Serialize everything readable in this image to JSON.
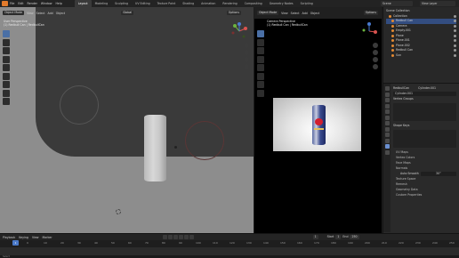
{
  "topbar": {
    "menu": [
      "File",
      "Edit",
      "Render",
      "Window",
      "Help"
    ],
    "tabs": [
      "Layout",
      "Modeling",
      "Sculpting",
      "UV Editing",
      "Texture Paint",
      "Shading",
      "Animation",
      "Rendering",
      "Compositing",
      "Geometry Nodes",
      "Scripting"
    ],
    "active_tab": "Layout",
    "scene": "Scene",
    "view_layer": "View Layer"
  },
  "viewport_left": {
    "mode": "Object Mode",
    "menus": [
      "View",
      "Select",
      "Add",
      "Object"
    ],
    "orientation": "Global",
    "options": "Options",
    "info_line1": "User Perspective",
    "info_line2": "(1) Redbull Can | RedbullCan"
  },
  "viewport_right": {
    "mode": "Object Mode",
    "menus": [
      "View",
      "Select",
      "Add",
      "Object"
    ],
    "options": "Options",
    "info_line1": "Camera Perspective",
    "info_line2": "(1) Redbull Can | RedbullCan"
  },
  "outliner": {
    "title": "Scene Collection",
    "rows": [
      {
        "label": "Collection"
      },
      {
        "label": "Redbull Can"
      },
      {
        "label": "Camera"
      },
      {
        "label": "Empty.001"
      },
      {
        "label": "Plane"
      },
      {
        "label": "Plane.001"
      },
      {
        "label": "Plane.002"
      },
      {
        "label": "Redbull Can"
      },
      {
        "label": "Sun"
      }
    ]
  },
  "properties": {
    "object_name": "RedbullCan",
    "mesh_name": "Cylinder.001",
    "data_field": "Cylinder.001",
    "sections": [
      "Vertex Groups",
      "Shape Keys",
      "UV Maps",
      "Vertex Colors",
      "Face Maps",
      "Normals",
      "Texture Space",
      "Remesh",
      "Geometry Data",
      "Custom Properties"
    ],
    "auto_smooth_label": "Auto Smooth",
    "auto_smooth_value": "30°"
  },
  "timeline": {
    "menus": [
      "Playback",
      "Keying",
      "View",
      "Marker"
    ],
    "current_frame": "1",
    "start_label": "Start",
    "start_value": "1",
    "end_label": "End",
    "end_value": "250",
    "ruler": [
      "0",
      "10",
      "20",
      "30",
      "40",
      "50",
      "60",
      "70",
      "80",
      "90",
      "100",
      "110",
      "120",
      "130",
      "140",
      "150",
      "160",
      "170",
      "180",
      "190",
      "200",
      "210",
      "220",
      "230",
      "240",
      "250"
    ]
  },
  "status": "Select"
}
